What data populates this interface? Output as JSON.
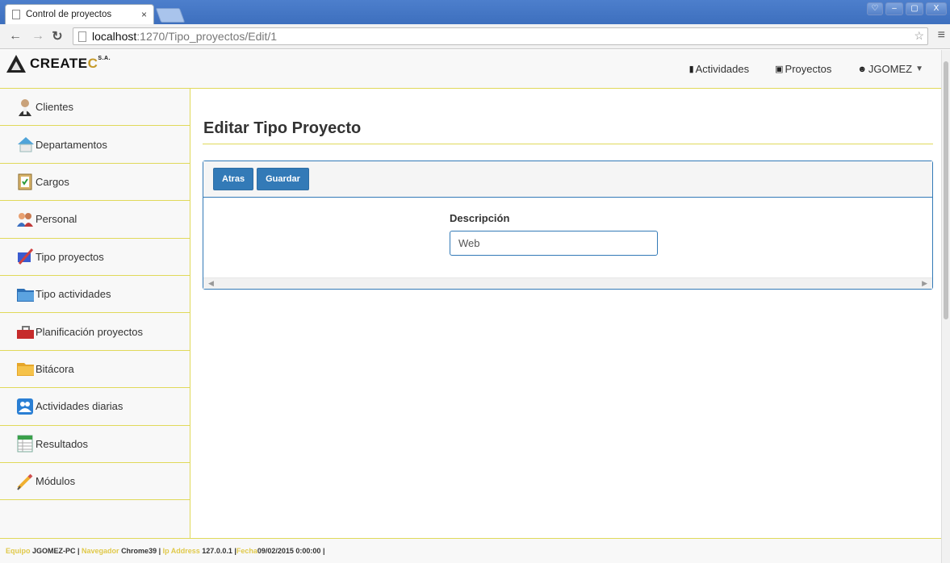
{
  "browser": {
    "tab_title": "Control de proyectos",
    "tab_close": "×",
    "url_host": "localhost",
    "url_path": ":1270/Tipo_proyectos/Edit/1",
    "window_buttons": [
      "♡",
      "–",
      "▢",
      "X"
    ]
  },
  "brand": {
    "name_a": "CREATE",
    "name_b": "C",
    "suffix": "S.A."
  },
  "topnav": {
    "activities": "Actividades",
    "projects": "Proyectos",
    "user": "JGOMEZ"
  },
  "sidebar": {
    "items": [
      {
        "label": "Clientes",
        "icon": "client-icon"
      },
      {
        "label": "Departamentos",
        "icon": "home-icon"
      },
      {
        "label": "Cargos",
        "icon": "clipboard-icon"
      },
      {
        "label": "Personal",
        "icon": "people-icon"
      },
      {
        "label": "Tipo proyectos",
        "icon": "pen-icon"
      },
      {
        "label": "Tipo actividades",
        "icon": "folder-icon"
      },
      {
        "label": "Planificación proyectos",
        "icon": "toolbox-icon"
      },
      {
        "label": "Bitácora",
        "icon": "folder-orange-icon"
      },
      {
        "label": "Actividades diarias",
        "icon": "team-icon"
      },
      {
        "label": "Resultados",
        "icon": "spreadsheet-icon"
      },
      {
        "label": "Módulos",
        "icon": "pencil-icon"
      }
    ]
  },
  "main": {
    "title": "Editar Tipo Proyecto",
    "buttons": {
      "back": "Atras",
      "save": "Guardar"
    },
    "form": {
      "label": "Descripción",
      "value": "Web"
    }
  },
  "footer": {
    "k1": "Equipo ",
    "v1": "JGOMEZ-PC | ",
    "k2": "Navegador ",
    "v2": "Chrome39 | ",
    "k3": "Ip Address ",
    "v3": "127.0.0.1 |",
    "k4": "Fecha",
    "v4": "09/02/2015 0:00:00 |"
  },
  "colors": {
    "primary": "#337ab7",
    "accent_border": "#e0d95a",
    "brand_gold": "#c59a2a"
  }
}
